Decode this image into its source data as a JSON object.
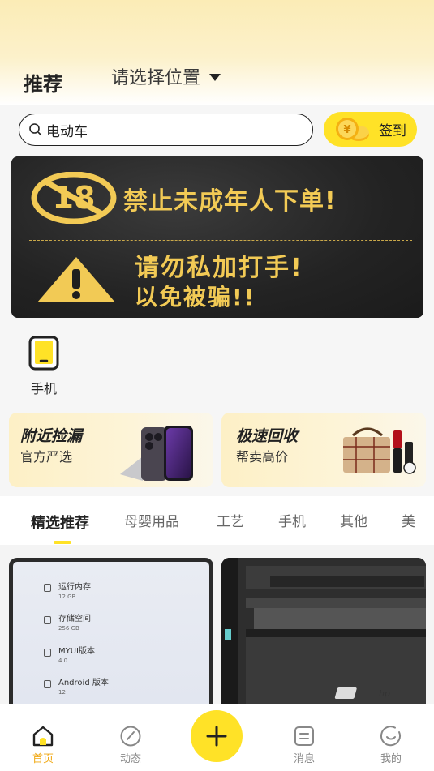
{
  "header": {
    "title": "推荐",
    "location_label": "请选择位置"
  },
  "search": {
    "value": "电动车"
  },
  "checkin": {
    "label": "签到"
  },
  "banner": {
    "line1": "禁止未成年人下单!",
    "line2": "请勿私加打手!",
    "line3": "以免被骗!!",
    "badge_text": "18"
  },
  "categories": [
    {
      "label": "手机",
      "icon": "phone-icon"
    }
  ],
  "promos": [
    {
      "title": "附近捡漏",
      "subtitle": "官方严选"
    },
    {
      "title": "极速回收",
      "subtitle": "帮卖高价"
    }
  ],
  "tabs": [
    {
      "label": "精选推荐",
      "active": true
    },
    {
      "label": "母婴用品"
    },
    {
      "label": "工艺"
    },
    {
      "label": "手机"
    },
    {
      "label": "其他"
    },
    {
      "label": "美"
    }
  ],
  "feed": {
    "card1_specs": [
      {
        "label": "运行内存",
        "value": "12 GB"
      },
      {
        "label": "存储空间",
        "value": "256 GB"
      },
      {
        "label": "MYUI版本",
        "value": "4.0"
      },
      {
        "label": "Android 版本",
        "value": "12"
      }
    ],
    "card2_brand": "hp"
  },
  "nav": {
    "items": [
      {
        "label": "首页",
        "icon": "home-icon",
        "active": true
      },
      {
        "label": "动态",
        "icon": "compass-icon"
      },
      {
        "label": "消息",
        "icon": "message-icon"
      },
      {
        "label": "我的",
        "icon": "profile-icon"
      }
    ]
  },
  "colors": {
    "accent": "#ffe227",
    "active_nav": "#f0a70f",
    "banner_text": "#f2ca55"
  }
}
